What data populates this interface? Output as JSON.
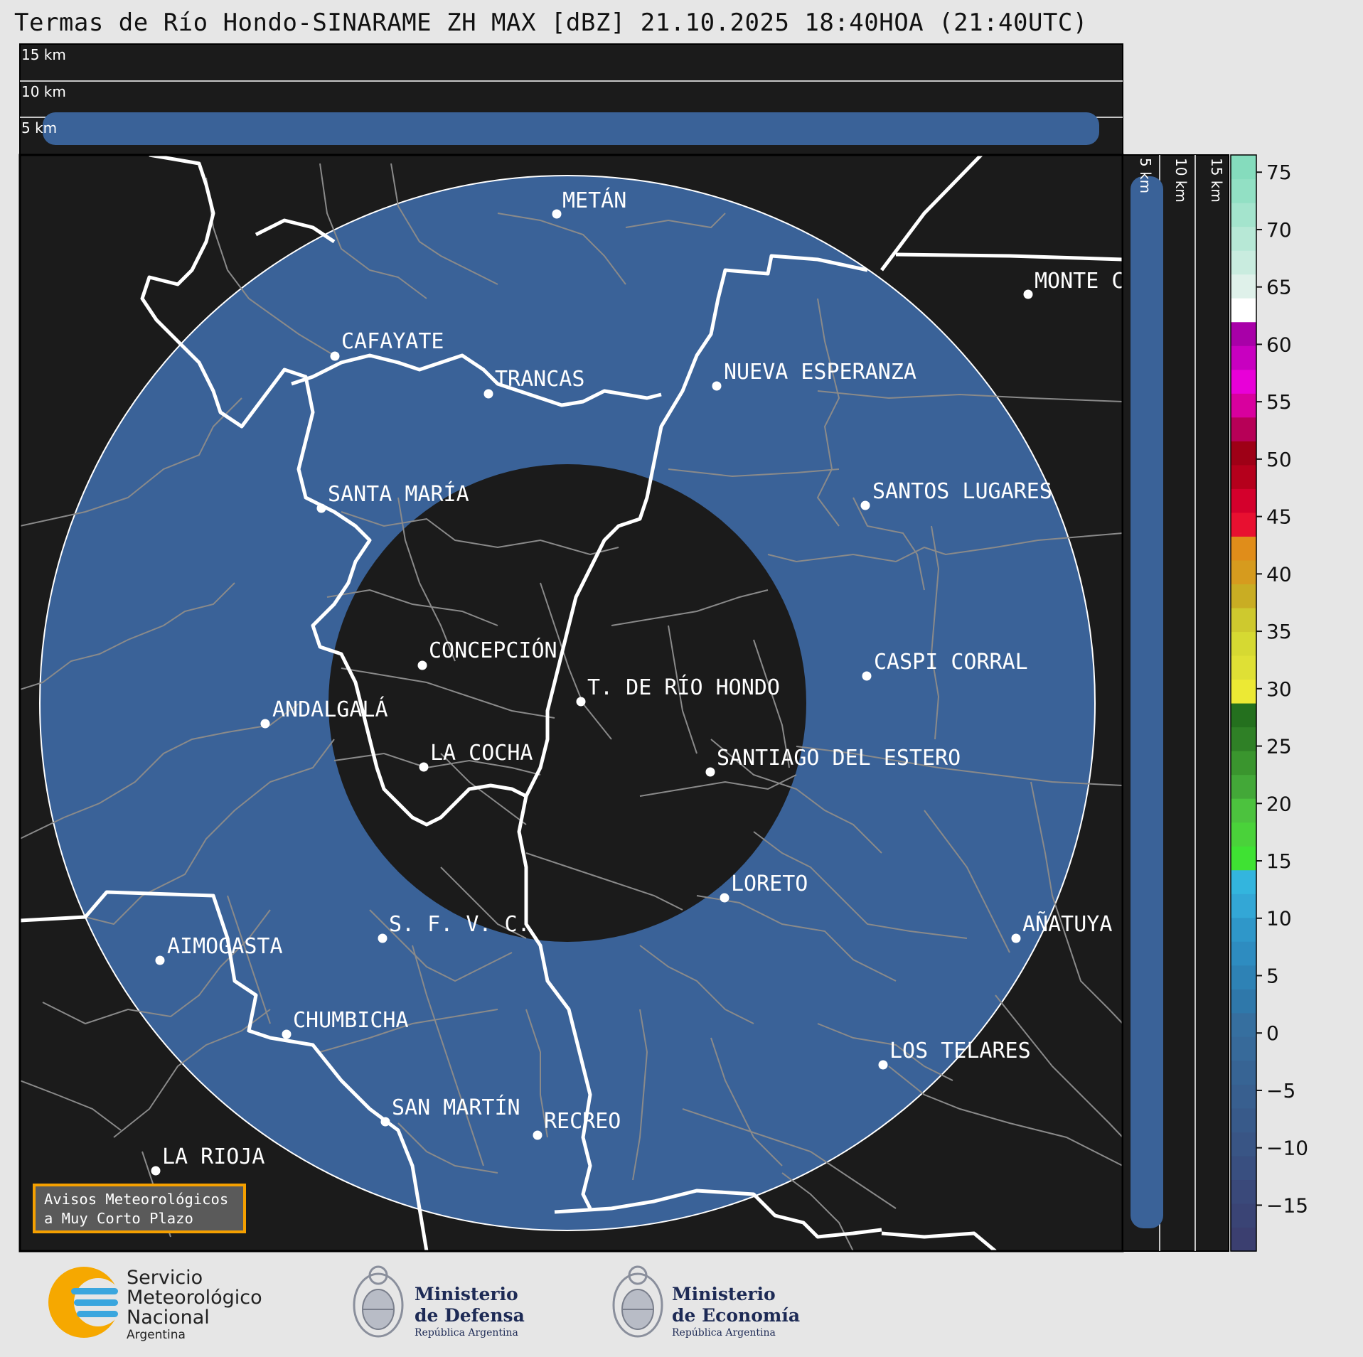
{
  "title": "Termas de Río Hondo-SINARAME ZH MAX [dBZ] 21.10.2025 18:40HOA (21:40UTC)",
  "altitude_labels": {
    "top_15": "15 km",
    "top_10": "10 km",
    "top_5": "5 km",
    "side_5": "5 km",
    "side_10": "10 km",
    "side_15": "15 km"
  },
  "cities": [
    {
      "name": "METÁN"
    },
    {
      "name": "CAFAYATE"
    },
    {
      "name": "TRANCAS"
    },
    {
      "name": "NUEVA ESPERANZA"
    },
    {
      "name": "MONTE C"
    },
    {
      "name": "SANTA MARÍA"
    },
    {
      "name": "SANTOS LUGARES"
    },
    {
      "name": "CONCEPCIÓN"
    },
    {
      "name": "T. DE RÍO HONDO"
    },
    {
      "name": "CASPI CORRAL"
    },
    {
      "name": "ANDALGALÁ"
    },
    {
      "name": "LA COCHA"
    },
    {
      "name": "SANTIAGO DEL ESTERO"
    },
    {
      "name": "LORETO"
    },
    {
      "name": "S. F. V. C."
    },
    {
      "name": "AÑATUYA"
    },
    {
      "name": "AIMOGASTA"
    },
    {
      "name": "CHUMBICHA"
    },
    {
      "name": "LOS TELARES"
    },
    {
      "name": "SAN MARTÍN"
    },
    {
      "name": "RECREO"
    },
    {
      "name": "LA RIOJA"
    }
  ],
  "colorbar": {
    "ticks": [
      "75",
      "70",
      "65",
      "60",
      "55",
      "50",
      "45",
      "40",
      "35",
      "30",
      "25",
      "20",
      "15",
      "10",
      "5",
      "0",
      "−5",
      "−10",
      "−15"
    ],
    "colors_bottom_to_top": [
      "#3b3f70",
      "#3a4475",
      "#3a497a",
      "#394f80",
      "#395585",
      "#385a8a",
      "#385f8f",
      "#376494",
      "#376a9a",
      "#366f9f",
      "#2f78aa",
      "#2e82b5",
      "#2e8cc0",
      "#2f97c9",
      "#33a7d6",
      "#33b5de",
      "#3fe233",
      "#4ad23a",
      "#4cc23e",
      "#43a838",
      "#3a952e",
      "#2f8026",
      "#24701e",
      "#ece934",
      "#dfe035",
      "#d6d932",
      "#cec92e",
      "#c9ad23",
      "#d69b1e",
      "#e08d1a",
      "#e81030",
      "#d4002c",
      "#b5001c",
      "#9e0016",
      "#b70057",
      "#d8009e",
      "#e800d8",
      "#c800c0",
      "#a800a8",
      "#ffffff",
      "#dff1ea",
      "#c9ecdf",
      "#b7e8d6",
      "#a4e4cd",
      "#92e0c4",
      "#85dcbd"
    ]
  },
  "panel_colors": {
    "echo": "#3a6298",
    "background": "#1b1b1b",
    "range_ring": "#ffffff"
  },
  "avisos": {
    "line1": "Avisos Meteorológicos",
    "line2": "a Muy Corto Plazo"
  },
  "logos": {
    "smn": {
      "line1": "Servicio",
      "line2": "Meteorológico",
      "line3": "Nacional",
      "line4": "Argentina"
    },
    "defensa": {
      "line1": "Ministerio",
      "line2": "de Defensa",
      "line3": "República Argentina"
    },
    "economia": {
      "line1": "Ministerio",
      "line2": "de Economía",
      "line3": "República Argentina"
    }
  }
}
